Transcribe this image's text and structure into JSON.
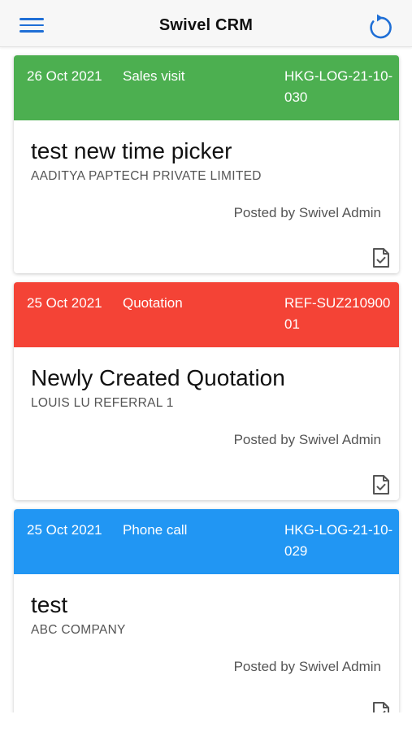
{
  "app": {
    "title": "Swivel CRM",
    "menu_icon": "hamburger-menu-icon",
    "refresh_icon": "refresh-icon",
    "accent_color": "#1f6fd6"
  },
  "cards": [
    {
      "date": "26 Oct 2021",
      "type": "Sales visit",
      "ref": "HKG-LOG-21-10-030",
      "color": "#4caf50",
      "subject": "test new time picker",
      "company": "AADITYA PAPTECH PRIVATE LIMITED",
      "posted_by": "Posted by Swivel Admin",
      "icon": "document-check-icon"
    },
    {
      "date": "25 Oct 2021",
      "type": "Quotation",
      "ref": "REF-SUZ21090001",
      "color": "#f44336",
      "subject": "Newly Created Quotation",
      "company": "LOUIS LU REFERRAL 1",
      "posted_by": "Posted by Swivel Admin",
      "icon": "document-check-icon"
    },
    {
      "date": "25 Oct 2021",
      "type": "Phone call",
      "ref": "HKG-LOG-21-10-029",
      "color": "#2196f3",
      "subject": "test",
      "company": "ABC COMPANY",
      "posted_by": "Posted by Swivel Admin",
      "icon": "document-check-icon"
    }
  ]
}
